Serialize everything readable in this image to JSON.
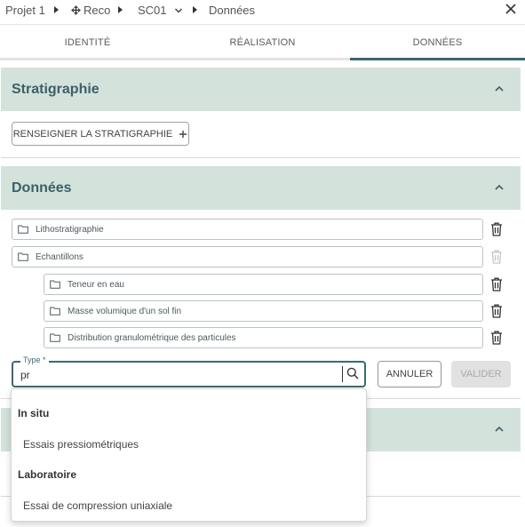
{
  "breadcrumb": {
    "items": [
      {
        "label": "Projet 1",
        "icon": "none"
      },
      {
        "label": "Reco",
        "icon": "diamond-move-icon"
      },
      {
        "label": "SC01",
        "icon": "chevron-down-icon"
      },
      {
        "label": "Données",
        "icon": "none"
      }
    ]
  },
  "tabs": [
    {
      "label": "IDENTITÉ",
      "active": false
    },
    {
      "label": "RÉALISATION",
      "active": false
    },
    {
      "label": "DONNÉES",
      "active": true
    }
  ],
  "stratigraphie": {
    "title": "Stratigraphie",
    "button_label": "RENSEIGNER LA STRATIGRAPHIE",
    "button_icon": "plus-icon"
  },
  "donnees": {
    "title": "Données",
    "folders": [
      {
        "label": "Lithostratigraphie",
        "indent": false,
        "trash_enabled": true
      },
      {
        "label": "Echantillons",
        "indent": false,
        "trash_enabled": false
      },
      {
        "label": "Teneur en eau",
        "indent": true,
        "trash_enabled": true
      },
      {
        "label": "Masse volumique d'un sol fin",
        "indent": true,
        "trash_enabled": true
      },
      {
        "label": "Distribution granulométrique des particules",
        "indent": true,
        "trash_enabled": true
      }
    ],
    "type_field": {
      "label": "Type *",
      "value": "pr"
    },
    "cancel_label": "ANNULER",
    "validate_label": "VALIDER"
  },
  "dropdown": {
    "groups": [
      {
        "label": "In situ",
        "items": [
          "Essais pressiométriques"
        ]
      },
      {
        "label": "Laboratoire",
        "items": [
          "Essai de compression uniaxiale"
        ]
      }
    ]
  },
  "colors": {
    "accent": "#3b6a73",
    "panel_header": "#d3e3dc",
    "disabled": "#e1e1e1"
  }
}
